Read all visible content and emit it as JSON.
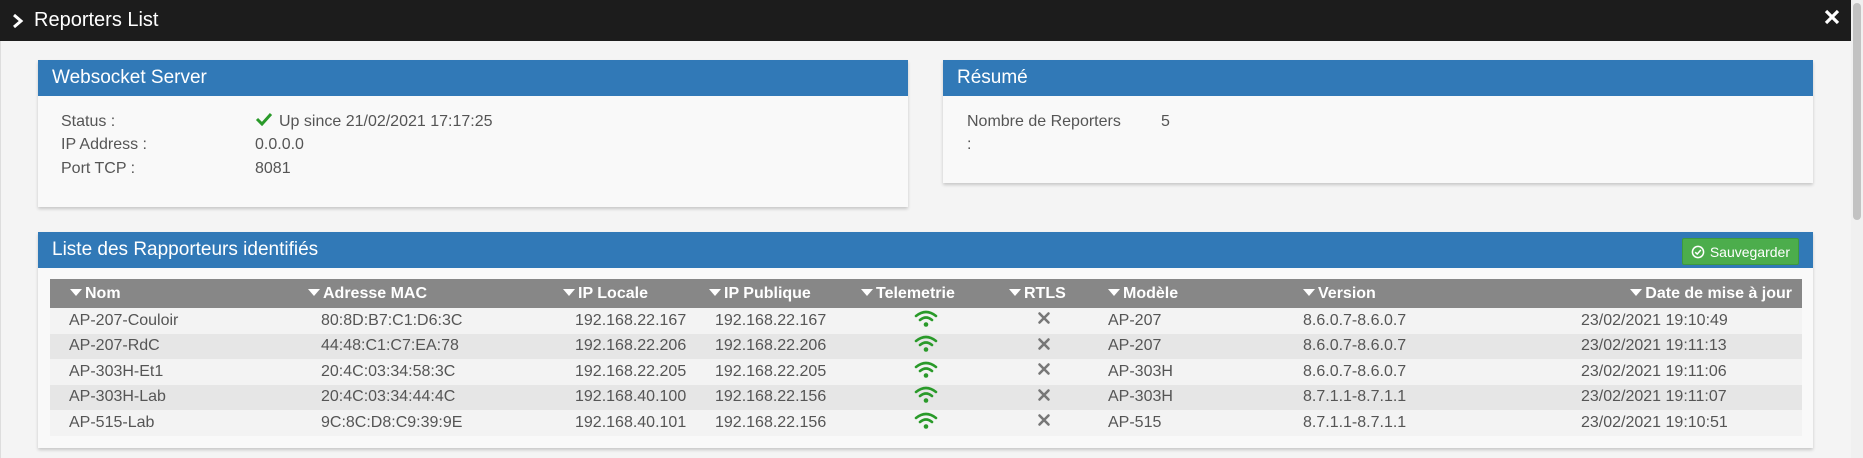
{
  "window": {
    "title": "Reporters List"
  },
  "websocket": {
    "heading": "Websocket Server",
    "rows": [
      {
        "key": "Status :",
        "value": "Up since 21/02/2021 17:17:25"
      },
      {
        "key": "IP Address :",
        "value": "0.0.0.0"
      },
      {
        "key": "Port TCP :",
        "value": "8081"
      }
    ]
  },
  "resume": {
    "heading": "Résumé",
    "label_line1": "Nombre de Reporters",
    "label_line2": ":",
    "value": "5"
  },
  "reporters": {
    "heading": "Liste des Rapporteurs identifiés",
    "save_label": "Sauvegarder",
    "columns": [
      "Nom",
      "Adresse MAC",
      "IP Locale",
      "IP Publique",
      "Telemetrie",
      "RTLS",
      "Modèle",
      "Version",
      "Date de mise à jour"
    ],
    "rows": [
      {
        "nom": "AP-207-Couloir",
        "mac": "80:8D:B7:C1:D6:3C",
        "ip_locale": "192.168.22.167",
        "ip_publique": "192.168.22.167",
        "telemetrie": "wifi-icon",
        "rtls": "x-icon",
        "modele": "AP-207",
        "version": "8.6.0.7-8.6.0.7",
        "date": "23/02/2021 19:10:49"
      },
      {
        "nom": "AP-207-RdC",
        "mac": "44:48:C1:C7:EA:78",
        "ip_locale": "192.168.22.206",
        "ip_publique": "192.168.22.206",
        "telemetrie": "wifi-icon",
        "rtls": "x-icon",
        "modele": "AP-207",
        "version": "8.6.0.7-8.6.0.7",
        "date": "23/02/2021 19:11:13"
      },
      {
        "nom": "AP-303H-Et1",
        "mac": "20:4C:03:34:58:3C",
        "ip_locale": "192.168.22.205",
        "ip_publique": "192.168.22.205",
        "telemetrie": "wifi-icon",
        "rtls": "x-icon",
        "modele": "AP-303H",
        "version": "8.6.0.7-8.6.0.7",
        "date": "23/02/2021 19:11:06"
      },
      {
        "nom": "AP-303H-Lab",
        "mac": "20:4C:03:34:44:4C",
        "ip_locale": "192.168.40.100",
        "ip_publique": "192.168.22.156",
        "telemetrie": "wifi-icon",
        "rtls": "x-icon",
        "modele": "AP-303H",
        "version": "8.7.1.1-8.7.1.1",
        "date": "23/02/2021 19:11:07"
      },
      {
        "nom": "AP-515-Lab",
        "mac": "9C:8C:D8:C9:39:9E",
        "ip_locale": "192.168.40.101",
        "ip_publique": "192.168.22.156",
        "telemetrie": "wifi-icon",
        "rtls": "x-icon",
        "modele": "AP-515",
        "version": "8.7.1.1-8.7.1.1",
        "date": "23/02/2021 19:10:51"
      }
    ]
  },
  "colors": {
    "header_blue": "#3179b7",
    "titlebar": "#1c1c1c",
    "ok_green": "#2a9a2a",
    "table_head": "#878787",
    "save_green": "#4cad4c"
  }
}
